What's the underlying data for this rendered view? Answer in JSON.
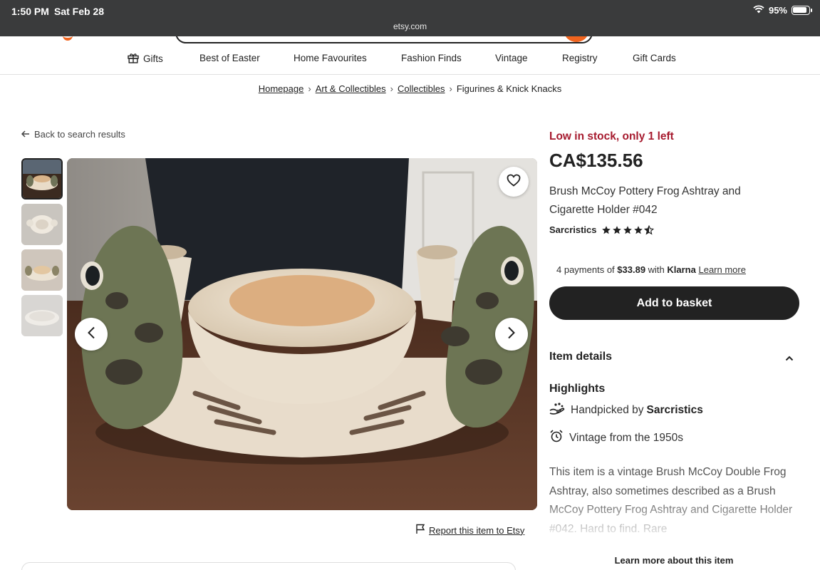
{
  "status_bar": {
    "time": "1:50 PM",
    "date": "Sat Feb 28",
    "url": "etsy.com",
    "battery": "95%"
  },
  "nav": {
    "items": [
      "Gifts",
      "Best of Easter",
      "Home Favourites",
      "Fashion Finds",
      "Vintage",
      "Registry",
      "Gift Cards"
    ]
  },
  "breadcrumb": {
    "items": [
      "Homepage",
      "Art & Collectibles",
      "Collectibles",
      "Figurines & Knick Knacks"
    ]
  },
  "back_link": "Back to search results",
  "listing": {
    "stock": "Low in stock, only 1 left",
    "price": "CA$135.56",
    "title": "Brush McCoy Pottery Frog Ashtray and Cigarette Holder #042",
    "shop": "Sarcristics",
    "rating": 4.5,
    "klarna": {
      "prefix": "4 payments of ",
      "amount": "$33.89",
      "with": " with ",
      "brand": "Klarna",
      "learn_more": "Learn more"
    },
    "add_to_basket": "Add to basket",
    "report": "Report this item to Etsy"
  },
  "details": {
    "heading": "Item details",
    "highlights_heading": "Highlights",
    "handpicked_prefix": "Handpicked by ",
    "handpicked_shop": "Sarcristics",
    "vintage": "Vintage from the 1950s",
    "description": "This item is a vintage Brush McCoy Double Frog Ashtray, also sometimes described as a Brush McCoy Pottery Frog Ashtray and Cigarette Holder #042. Hard to find. Rare",
    "learn_more": "Learn more about this item"
  },
  "icons": {
    "gift": "gift-icon",
    "back": "arrow-left-icon",
    "heart": "heart-icon",
    "prev": "chevron-left-icon",
    "next": "chevron-right-icon",
    "flag": "flag-icon",
    "collapse": "chevron-up-icon",
    "hand": "hand-icon",
    "alarm": "alarm-clock-icon"
  },
  "colors": {
    "stock": "#a61a2e",
    "button": "#222222",
    "brand": "#f1641e"
  }
}
